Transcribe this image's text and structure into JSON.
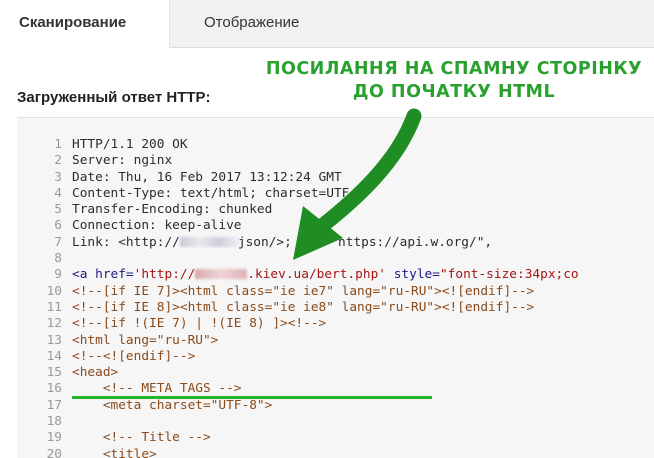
{
  "tabs": [
    {
      "label": "Сканирование",
      "active": true
    },
    {
      "label": "Отображение",
      "active": false
    }
  ],
  "section_title": "Загруженный ответ HTTP:",
  "annotation": {
    "line1": "ПОСИЛАННЯ НА СПАМНУ СТОРІНКУ",
    "line2": "ДО ПОЧАТКУ HTML",
    "color": "#2aa12f"
  },
  "code": {
    "line_numbers": [
      "1",
      "2",
      "3",
      "4",
      "5",
      "6",
      "7",
      "8",
      "9",
      "10",
      "11",
      "12",
      "13",
      "14",
      "15",
      "16",
      "17",
      "18",
      "19",
      "20"
    ],
    "lines": {
      "l1": "HTTP/1.1 200 OK",
      "l2": "Server: nginx",
      "l3": "Date: Thu, 16 Feb 2017 13:12:24 GMT",
      "l4": "Content-Type: text/html; charset=UTF-8",
      "l5": "Transfer-Encoding: chunked",
      "l6": "Connection: keep-alive",
      "l7a": "Link: <http://",
      "l7b": "json/>; rel=\"https://api.w.org/\",",
      "l9_tag": "<a ",
      "l9_attr1": "href",
      "l9_eq1": "=",
      "l9_str1a": "'http://",
      "l9_str1b": ".kiev.ua/bert.php'",
      "l9_attr2": " style",
      "l9_eq2": "=",
      "l9_str2": "\"font-size:34px;co",
      "l10": "<!--[if IE 7]><html class=\"ie ie7\" lang=\"ru-RU\"><![endif]-->",
      "l11": "<!--[if IE 8]><html class=\"ie ie8\" lang=\"ru-RU\"><![endif]-->",
      "l12": "<!--[if !(IE 7) | !(IE 8) ]><!-->",
      "l13": "<html lang=\"ru-RU\">",
      "l14": "<!--<![endif]-->",
      "l15": "<head>",
      "l16": "    <!-- META TAGS -->",
      "l17": "    <meta charset=\"UTF-8\">",
      "l18": "",
      "l19": "    <!-- Title -->",
      "l20": "    <title>"
    }
  },
  "colors": {
    "annotation_green": "#2aa12f",
    "underline_green": "#27b52b",
    "arrow_green": "#1f8d24"
  }
}
